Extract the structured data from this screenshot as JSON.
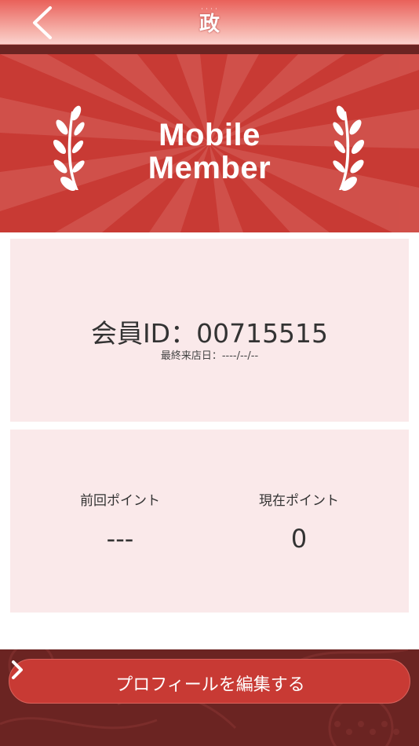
{
  "header": {
    "back_icon": "chevron-left-icon",
    "logo_top_text": "・・・・",
    "logo_char": "政"
  },
  "banner": {
    "title_line1": "Mobile",
    "title_line2": "Member",
    "color": "#c83a34"
  },
  "member": {
    "id_text": "会員ID：00715515",
    "last_visit_text": "最終来店日：----/--/--"
  },
  "points": {
    "previous_label": "前回ポイント",
    "previous_value": "---",
    "current_label": "現在ポイント",
    "current_value": "0"
  },
  "footer": {
    "edit_button_label": "プロフィールを編集する",
    "edit_button_icon": "chevron-right-icon"
  },
  "colors": {
    "accent": "#c83a34",
    "card_bg": "#fae9ea",
    "dark": "#6b2422"
  }
}
